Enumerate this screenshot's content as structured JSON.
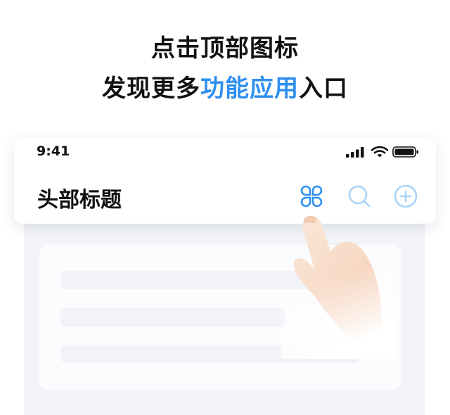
{
  "headline": {
    "line1": "点击顶部图标",
    "line2_before": "发现更多",
    "line2_highlight": "功能应用",
    "line2_after": "入口"
  },
  "status_bar": {
    "time": "9:41",
    "icons": [
      "signal-icon",
      "wifi-icon",
      "battery-icon"
    ]
  },
  "nav_bar": {
    "title": "头部标题",
    "actions": [
      "apps-icon",
      "search-icon",
      "add-icon"
    ]
  },
  "colors": {
    "accent": "#2e8ff0",
    "icon_faded": "#a9d3f6",
    "text": "#111111",
    "background_panel": "#f3f4f8"
  }
}
